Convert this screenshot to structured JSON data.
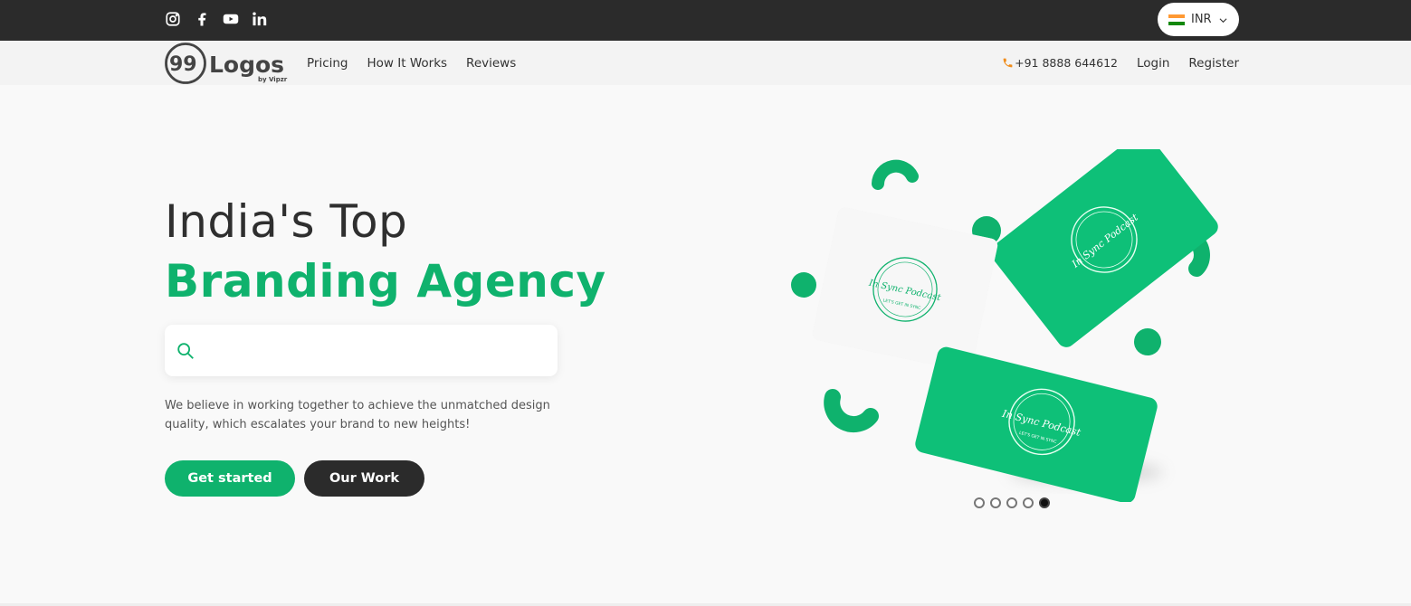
{
  "topbar": {
    "social": [
      "instagram-icon",
      "facebook-icon",
      "youtube-icon",
      "linkedin-icon"
    ],
    "currency": {
      "code": "INR",
      "flag_colors": [
        "#ff9933",
        "#ffffff",
        "#138808"
      ]
    }
  },
  "nav": {
    "logo_text": "99Logos",
    "logo_sub": "by Vipzr",
    "links": [
      "Pricing",
      "How It Works",
      "Reviews"
    ],
    "phone": "+91 8888 644612",
    "login": "Login",
    "register": "Register"
  },
  "hero": {
    "title_line1": "India's Top",
    "title_line2": "Branding Agency",
    "search": {
      "value": "",
      "placeholder": ""
    },
    "tagline": "We believe in working together to achieve the unmatched design quality, which escalates your brand to new heights!",
    "cta_primary": "Get started",
    "cta_secondary": "Our Work"
  },
  "illustration": {
    "card_brand": "In Sync Podcast",
    "card_motto": "LET'S GET IN SYNC"
  },
  "carousel": {
    "slide_count": 5,
    "active_index": 4
  },
  "colors": {
    "accent": "#0fb26d",
    "dark": "#2b2b2b",
    "phone_icon": "#f08c1a"
  }
}
